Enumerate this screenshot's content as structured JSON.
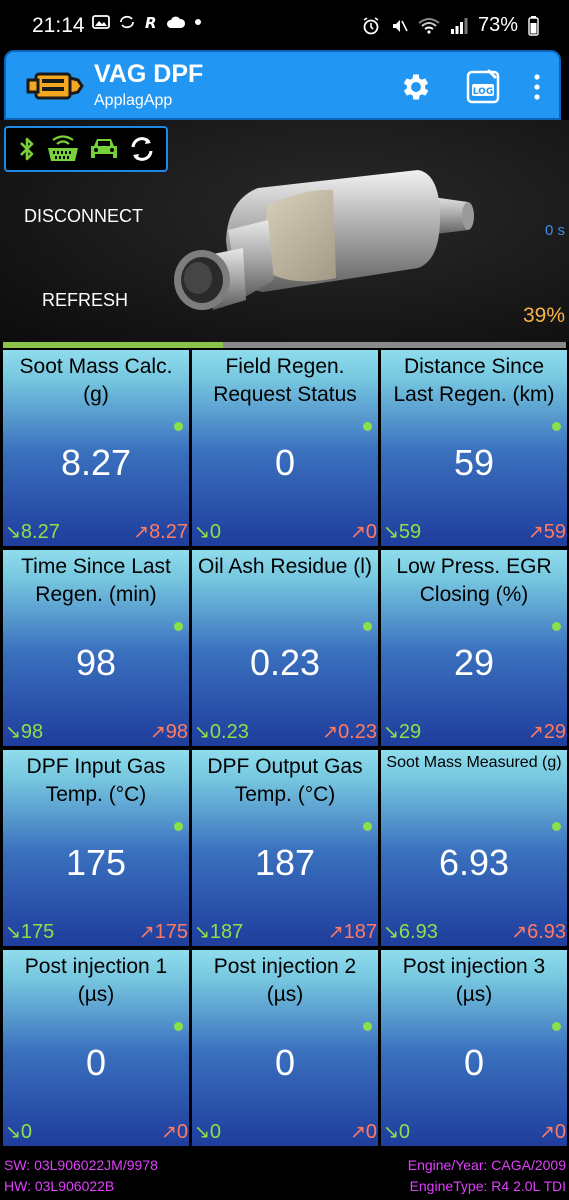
{
  "status_bar": {
    "time": "21:14",
    "battery": "73%",
    "left_icons": [
      "image-icon",
      "sync-icon",
      "r-icon",
      "cloud-icon",
      "dot-icon"
    ],
    "right_icons": [
      "alarm-icon",
      "mute-icon",
      "wifi-icon",
      "signal-icon",
      "battery-icon"
    ]
  },
  "app_bar": {
    "title": "VAG DPF",
    "subtitle": "ApplagApp",
    "log_label": "LOG",
    "color": "#2196f3"
  },
  "connection": {
    "disconnect_label": "DISCONNECT",
    "refresh_label": "REFRESH",
    "timer": "0 s",
    "percent": "39%",
    "progress_fraction": 0.39,
    "status_icons": [
      "bluetooth-icon",
      "obd-adapter-icon",
      "car-icon",
      "sync-icon"
    ]
  },
  "tiles": [
    {
      "title": "Soot Mass Calc. (g)",
      "value": "8.27",
      "min": "8.27",
      "max": "8.27"
    },
    {
      "title": "Field Regen. Request Status",
      "value": "0",
      "min": "0",
      "max": "0"
    },
    {
      "title": "Distance Since Last Regen. (km)",
      "value": "59",
      "min": "59",
      "max": "59"
    },
    {
      "title": "Time Since Last Regen. (min)",
      "value": "98",
      "min": "98",
      "max": "98"
    },
    {
      "title": "Oil Ash Residue (l)",
      "value": "0.23",
      "min": "0.23",
      "max": "0.23"
    },
    {
      "title": "Low Press. EGR Closing (%)",
      "value": "29",
      "min": "29",
      "max": "29"
    },
    {
      "title": "DPF Input Gas Temp. (°C)",
      "value": "175",
      "min": "175",
      "max": "175"
    },
    {
      "title": "DPF Output Gas Temp. (°C)",
      "value": "187",
      "min": "187",
      "max": "187"
    },
    {
      "title": "Soot Mass Measured (g)",
      "value": "6.93",
      "min": "6.93",
      "max": "6.93"
    },
    {
      "title": "Post injection 1 (µs)",
      "value": "0",
      "min": "0",
      "max": "0"
    },
    {
      "title": "Post injection 2 (µs)",
      "value": "0",
      "min": "0",
      "max": "0"
    },
    {
      "title": "Post injection 3 (µs)",
      "value": "0",
      "min": "0",
      "max": "0"
    }
  ],
  "footer": {
    "sw": "SW: 03L906022JM/9978",
    "hw": "HW: 03L906022B",
    "engine_year": "Engine/Year: CAGA/2009",
    "engine_type": "EngineType: R4 2.0L TDI"
  },
  "colors": {
    "accent": "#2196f3",
    "min_color": "#8be04a",
    "max_color": "#ff7a62",
    "percent_color": "#f5b54a",
    "footer_color": "#e040fb"
  }
}
